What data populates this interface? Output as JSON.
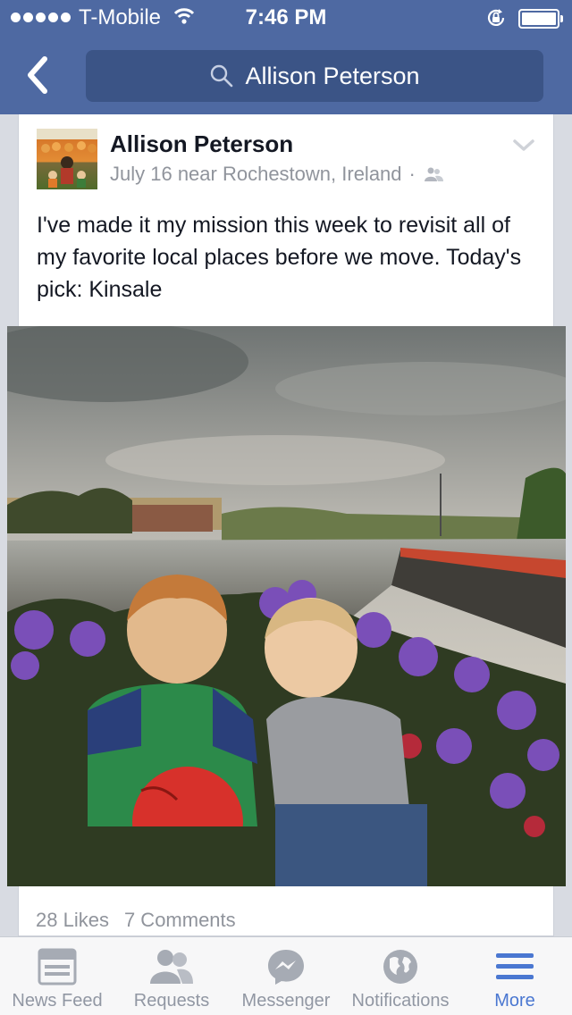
{
  "status_bar": {
    "carrier": "T-Mobile",
    "time": "7:46 PM"
  },
  "header": {
    "search_text": "Allison Peterson"
  },
  "post": {
    "author": "Allison Peterson",
    "date_location": "July 16 near Rochestown, Ireland",
    "separator": "·",
    "message": "I've made it my mission this week to revisit all of my favorite local places before we move. Today's pick: Kinsale",
    "likes": "28 Likes",
    "comments": "7 Comments"
  },
  "tabs": [
    {
      "label": "News Feed",
      "icon": "news-feed-icon"
    },
    {
      "label": "Requests",
      "icon": "friends-icon"
    },
    {
      "label": "Messenger",
      "icon": "messenger-icon"
    },
    {
      "label": "Notifications",
      "icon": "globe-icon"
    },
    {
      "label": "More",
      "icon": "menu-icon",
      "active": true
    }
  ],
  "colors": {
    "brand": "#4e69a2",
    "active_tab": "#4a77d1",
    "muted": "#90949c"
  }
}
